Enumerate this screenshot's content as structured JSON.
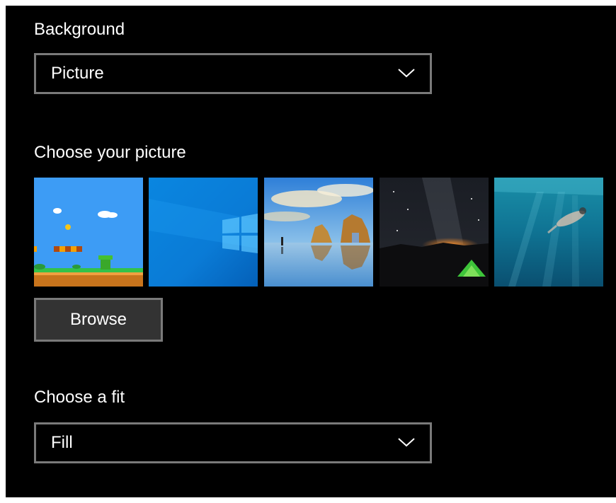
{
  "background": {
    "label": "Background",
    "selected": "Picture"
  },
  "picture": {
    "label": "Choose your picture",
    "thumbnails": [
      {
        "icon": "mario-level-thumbnail"
      },
      {
        "icon": "windows-logo-thumbnail"
      },
      {
        "icon": "beach-rocks-thumbnail"
      },
      {
        "icon": "night-sky-tent-thumbnail"
      },
      {
        "icon": "underwater-swimmer-thumbnail"
      }
    ],
    "browse_label": "Browse"
  },
  "fit": {
    "label": "Choose a fit",
    "selected": "Fill"
  },
  "colors": {
    "panel_background": "#000000",
    "border": "#7a7a7a",
    "button_background": "#333333",
    "text": "#ffffff"
  }
}
